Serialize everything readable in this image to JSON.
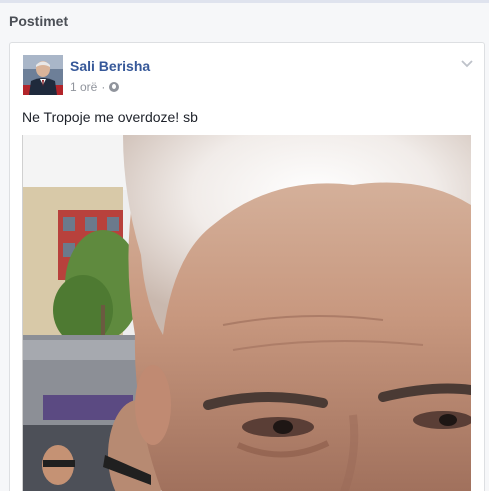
{
  "section": {
    "title": "Postimet"
  },
  "post": {
    "author": "Sali Berisha",
    "time": "1 orë",
    "separator": "·",
    "privacy_icon": "globe-icon",
    "menu_icon": "chevron-down-icon",
    "text": "Ne Tropoje me overdoze! sb",
    "photo_icon": "post-photo"
  },
  "colors": {
    "author_link": "#365899",
    "meta_text": "#90949c",
    "body_text": "#1d2129",
    "card_border": "#dddfe2",
    "page_bg": "#f6f7f9"
  }
}
